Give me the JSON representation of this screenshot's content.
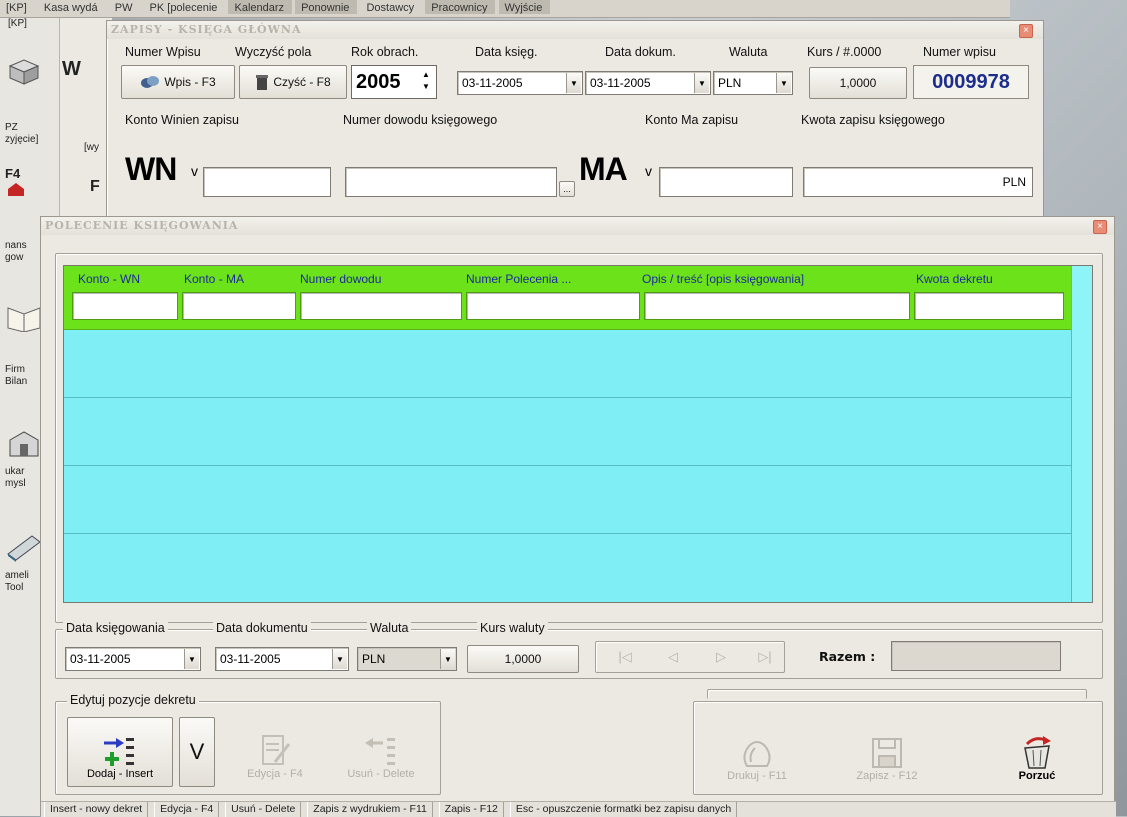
{
  "base_app": {
    "menu": [
      "[KP]",
      "Kasa wydá",
      "PW",
      "PK [polecenie",
      "Kalendarz",
      "Ponownie",
      "Dostawcy",
      "Pracownicy",
      "Wyjście"
    ],
    "left_tools": [
      {
        "label": "PZ",
        "sub": "zyjęcie]"
      },
      {
        "label": "F4",
        "sub": ""
      },
      {
        "label": "nans",
        "sub": "gow"
      },
      {
        "label": "Firm",
        "sub": "Bilan"
      },
      {
        "label": "ukar",
        "sub": "mysl"
      },
      {
        "label": "ameli",
        "sub": "Tool"
      }
    ],
    "mid": {
      "line1": "[wy",
      "kp": "[KP]",
      "f": "F",
      "pz": "PZ"
    }
  },
  "back_window": {
    "title": "ZAPISY - KSIĘGA GŁÓWNA",
    "close": "×",
    "labels": {
      "numer_wpisu": "Numer Wpisu",
      "wyczysc_pola": "Wyczyść pola",
      "rok_obrach": "Rok obrach.",
      "data_kieg": "Data księg.",
      "data_dokum": "Data dokum.",
      "waluta": "Waluta",
      "kurs": "Kurs / #.0000",
      "numer_wpisu_r": "Numer wpisu",
      "konto_winien": "Konto  Winien  zapisu",
      "numer_dowodu": "Numer dowodu księgowego",
      "konto_ma": "Konto   Ma   zapisu",
      "kwota_zapisu": "Kwota zapisu księgowego"
    },
    "buttons": {
      "wpis": "Wpis - F3",
      "czysc": "Czyść - F8"
    },
    "values": {
      "rok": "2005",
      "data_kieg": "03-11-2005",
      "data_dokum": "03-11-2005",
      "waluta": "PLN",
      "kurs": "1,0000",
      "numer": "0009978",
      "wn": "WN",
      "ma": "MA",
      "v": "v",
      "pln": "PLN",
      "dots": "..."
    }
  },
  "front_window": {
    "title": "POLECENIE KSIĘGOWANIA",
    "close": "×",
    "grid": {
      "columns": [
        "Konto - WN",
        "Konto - MA",
        "Numer dowodu",
        "Numer Polecenia ...",
        "Opis / treść [opis księgowania]",
        "Kwota dekretu"
      ],
      "rows": [
        {},
        {},
        {},
        {}
      ]
    },
    "bottom": {
      "data_ksiegowania_label": "Data księgowania",
      "data_dokumentu_label": "Data dokumentu",
      "waluta_label": "Waluta",
      "kurs_label": "Kurs waluty",
      "data_ksiegowania": "03-11-2005",
      "data_dokumentu": "03-11-2005",
      "waluta": "PLN",
      "kurs": "1,0000",
      "razem_label": "Razem :",
      "razem": "",
      "nav": {
        "first": "|◁",
        "prev": "◁",
        "next": "▷",
        "last": "▷|"
      }
    },
    "edit_group": {
      "label": "Edytuj  pozycje dekretu",
      "dodaj": "Dodaj - Insert",
      "v": "V",
      "edycja": "Edycja - F4",
      "usun": "Usuń - Delete"
    },
    "actions": {
      "drukuj": "Drukuj - F11",
      "zapisz": "Zapisz  - F12",
      "porzuc": "Porzuć"
    },
    "status": [
      "Insert - nowy dekret",
      "Edycja - F4",
      "Usuń - Delete",
      "Zapis z wydrukiem - F11",
      "Zapis - F12",
      "Esc - opuszczenie formatki bez zapisu danych"
    ]
  }
}
